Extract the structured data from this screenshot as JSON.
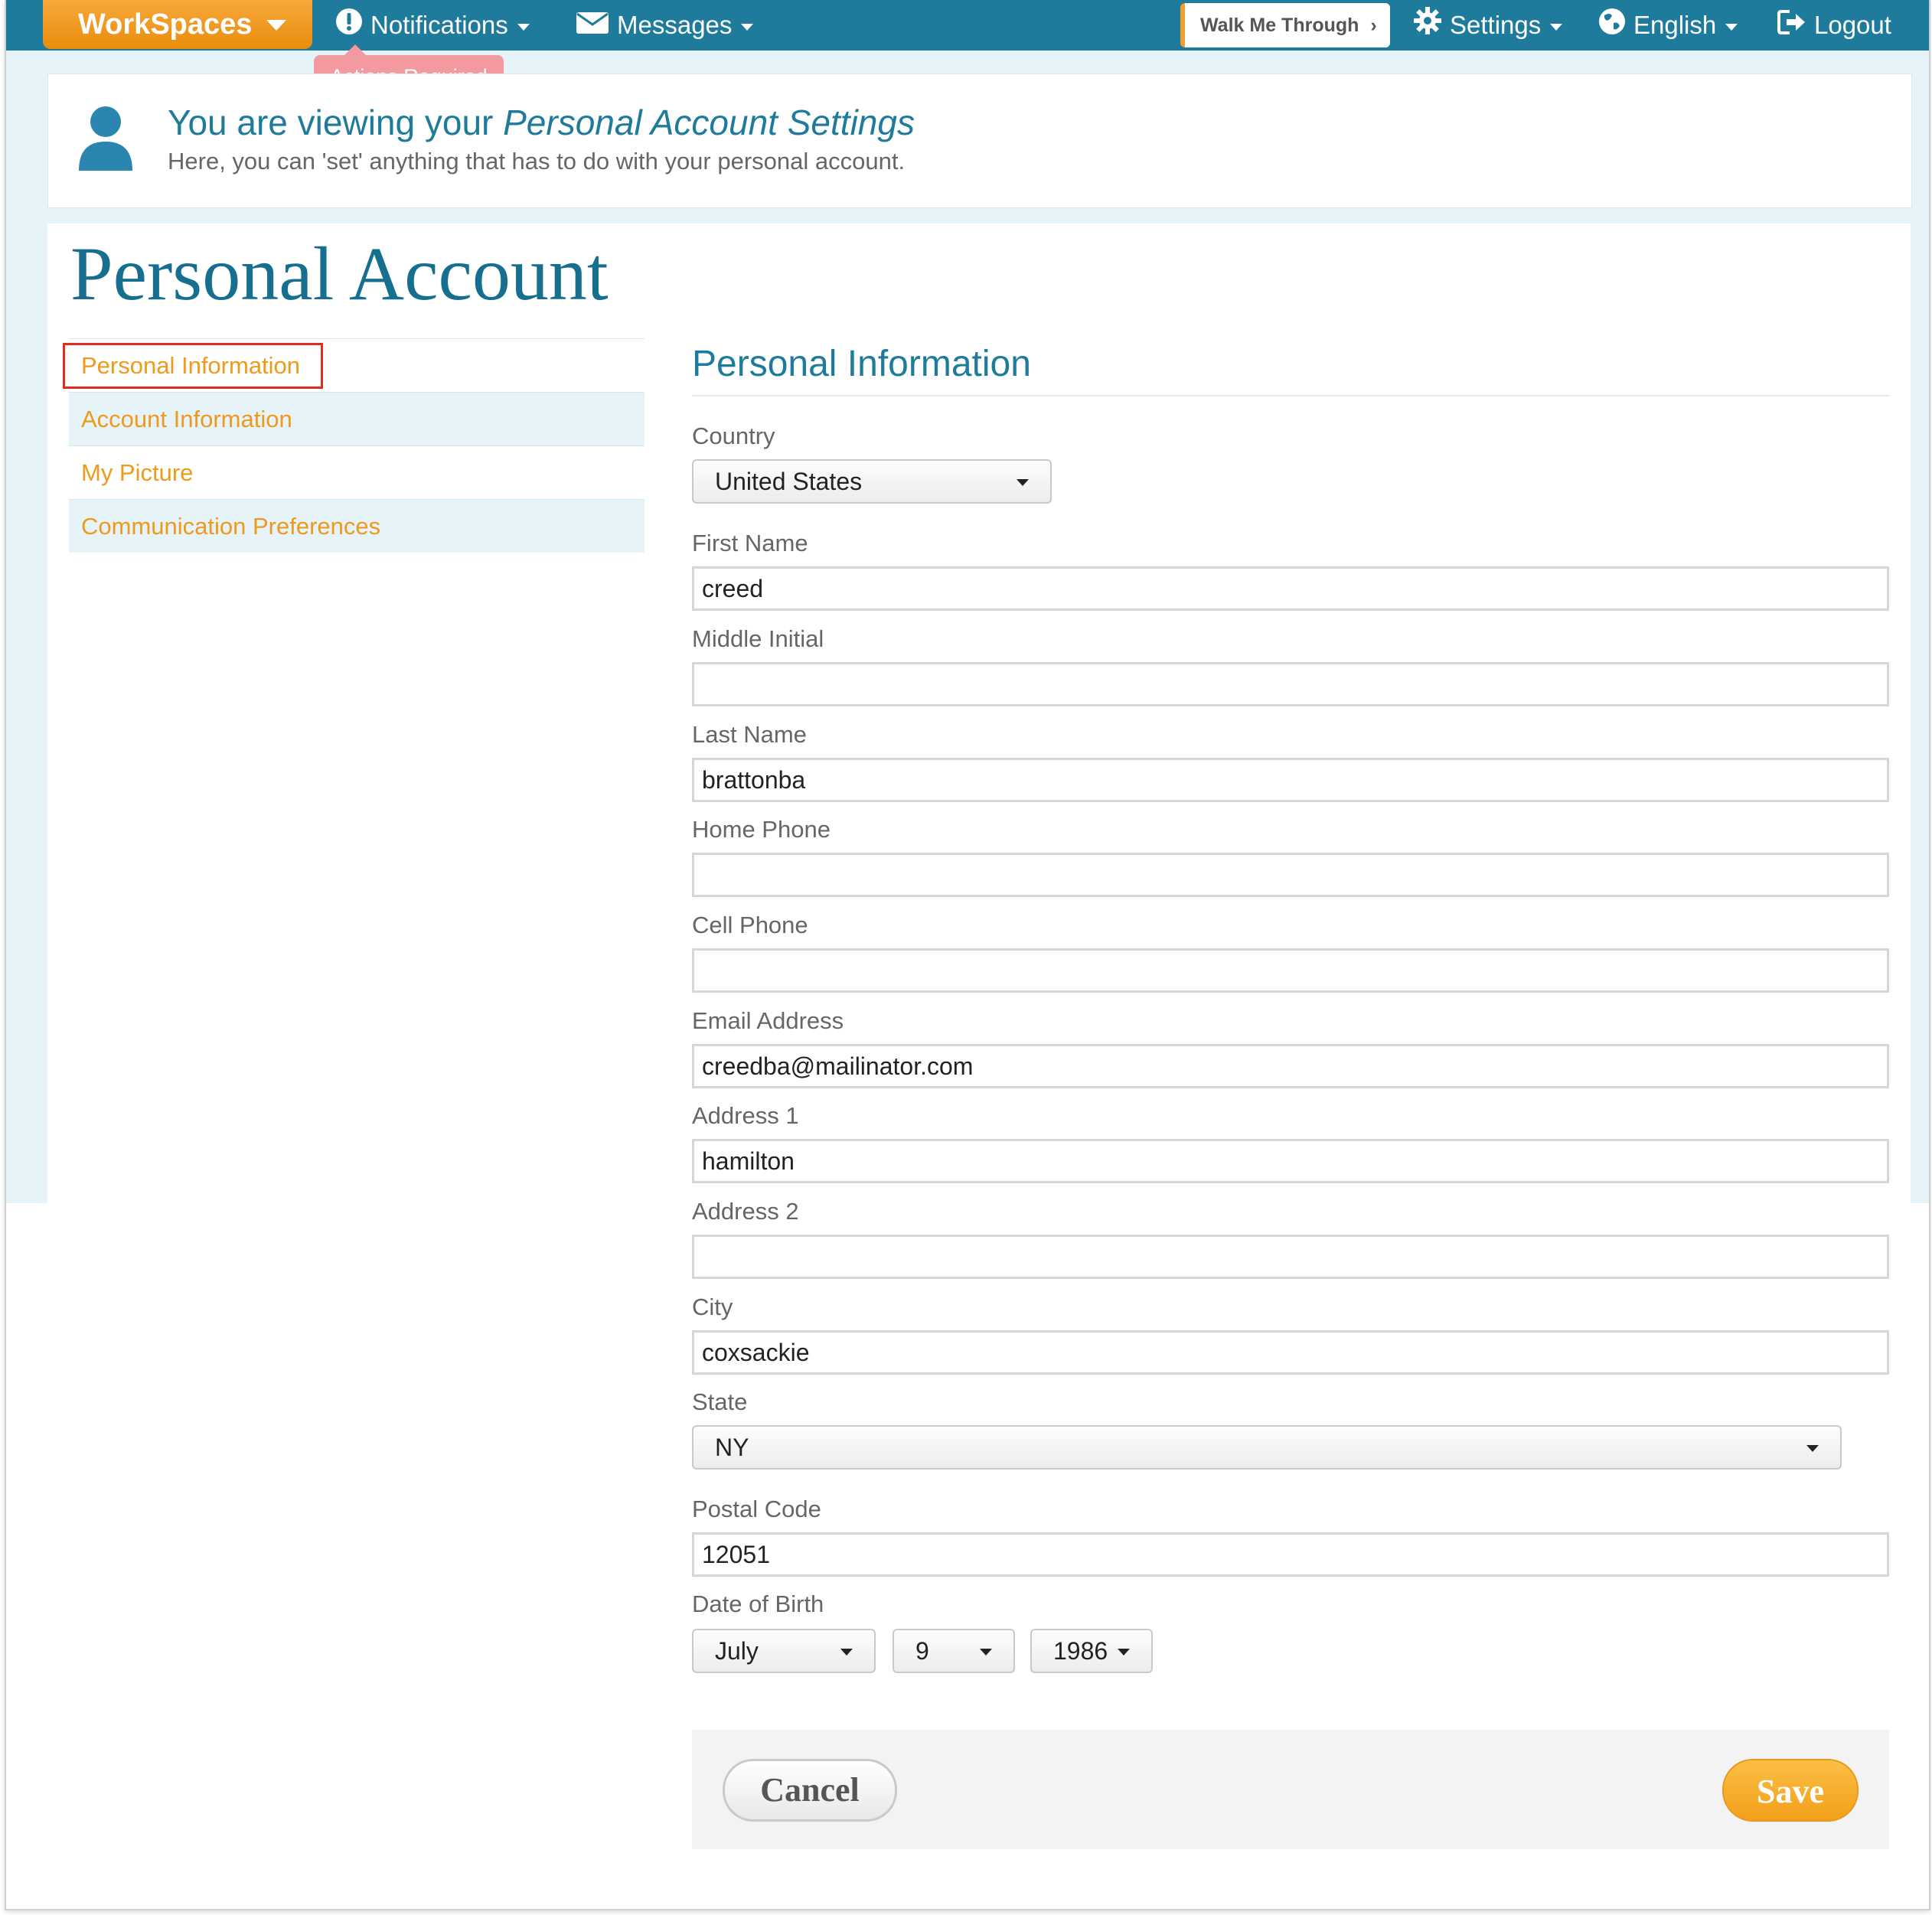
{
  "nav": {
    "workspaces_label": "WorkSpaces",
    "notifications_label": "Notifications",
    "messages_label": "Messages",
    "walk_me_label": "Walk Me Through",
    "settings_label": "Settings",
    "language_label": "English",
    "logout_label": "Logout",
    "actions_required": "Actions Required"
  },
  "header": {
    "title_prefix": "You are viewing your ",
    "title_emphasis": "Personal Account Settings",
    "subtitle": "Here, you can 'set' anything that has to do with your personal account."
  },
  "page_title": "Personal Account",
  "sidebar": {
    "items": [
      {
        "label": "Personal Information"
      },
      {
        "label": "Account Information"
      },
      {
        "label": "My Picture"
      },
      {
        "label": "Communication Preferences"
      }
    ]
  },
  "form": {
    "section_title": "Personal Information",
    "country": {
      "label": "Country",
      "value": "United States"
    },
    "first_name": {
      "label": "First Name",
      "value": "creed"
    },
    "middle_initial": {
      "label": "Middle Initial",
      "value": ""
    },
    "last_name": {
      "label": "Last Name",
      "value": "brattonba"
    },
    "home_phone": {
      "label": "Home Phone",
      "value": ""
    },
    "cell_phone": {
      "label": "Cell Phone",
      "value": ""
    },
    "email": {
      "label": "Email Address",
      "value": "creedba@mailinator.com"
    },
    "address1": {
      "label": "Address 1",
      "value": "hamilton"
    },
    "address2": {
      "label": "Address 2",
      "value": ""
    },
    "city": {
      "label": "City",
      "value": "coxsackie"
    },
    "state": {
      "label": "State",
      "value": "NY"
    },
    "postal_code": {
      "label": "Postal Code",
      "value": "12051"
    },
    "dob": {
      "label": "Date of Birth",
      "month": "July",
      "day": "9",
      "year": "1986"
    },
    "cancel_label": "Cancel",
    "save_label": "Save"
  },
  "colors": {
    "nav_bg": "#1e7b9c",
    "accent_orange": "#f2a01a",
    "link_orange": "#ee9a1a",
    "title_blue": "#1e7b9c"
  }
}
